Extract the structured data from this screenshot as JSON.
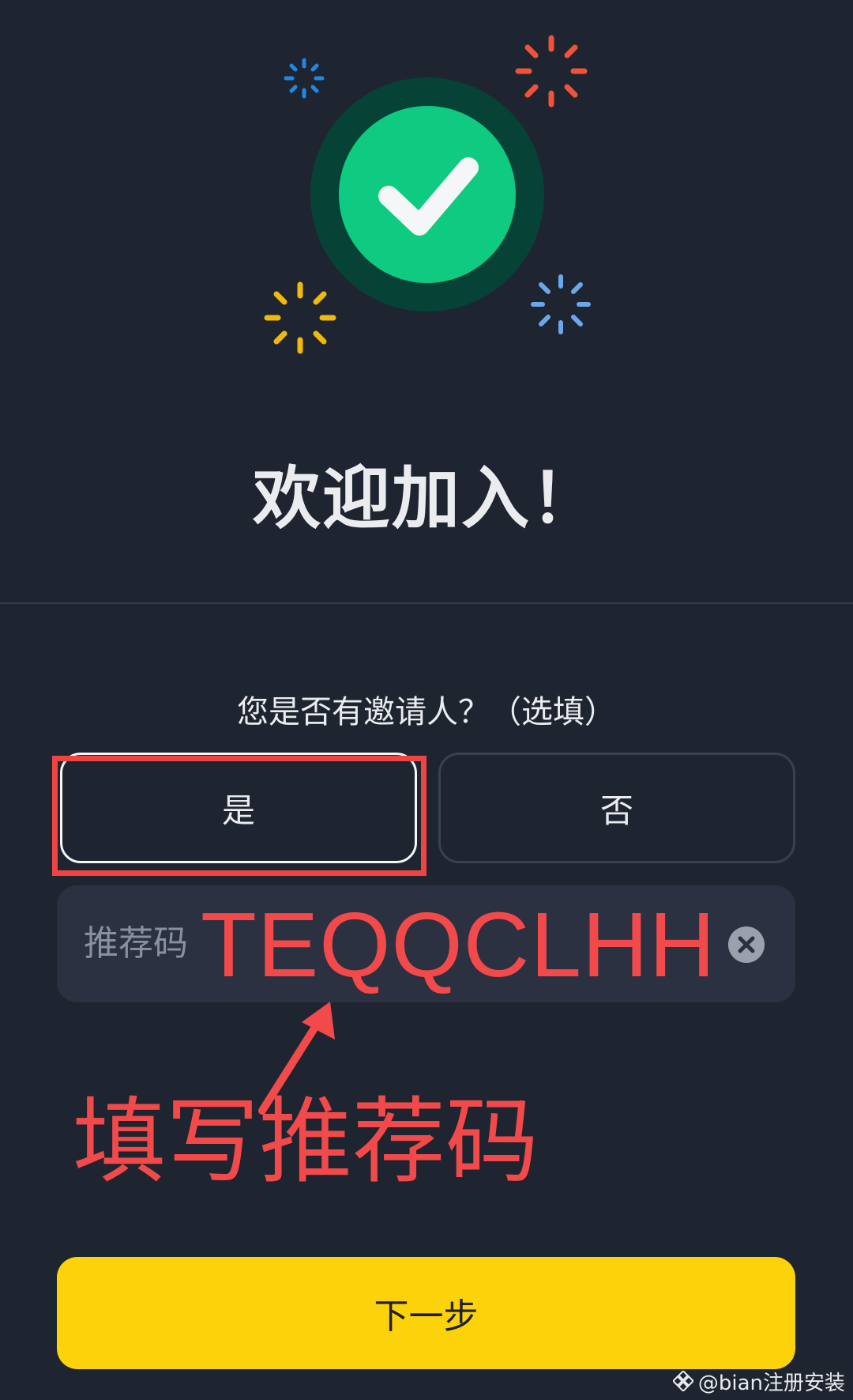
{
  "header": {
    "title": "欢迎加入！"
  },
  "referral_prompt": {
    "question": "您是否有邀请人？（选填）",
    "options": [
      {
        "label": "是",
        "selected": true
      },
      {
        "label": "否",
        "selected": false
      }
    ]
  },
  "referral_input": {
    "label": "推荐码",
    "value": "TEQQCLHH"
  },
  "annotation": {
    "text": "填写推荐码"
  },
  "footer": {
    "next_label": "下一步"
  },
  "watermark": {
    "text": "@bian注册安装"
  },
  "colors": {
    "background": "#1f2530",
    "success_green": "#0ecb81",
    "brand_yellow": "#fcd20b",
    "annotation_red": "#f24a4a"
  },
  "icons": {
    "hero": "success-check-icon",
    "clear": "clear-icon",
    "annotation_arrow": "arrow-icon"
  }
}
